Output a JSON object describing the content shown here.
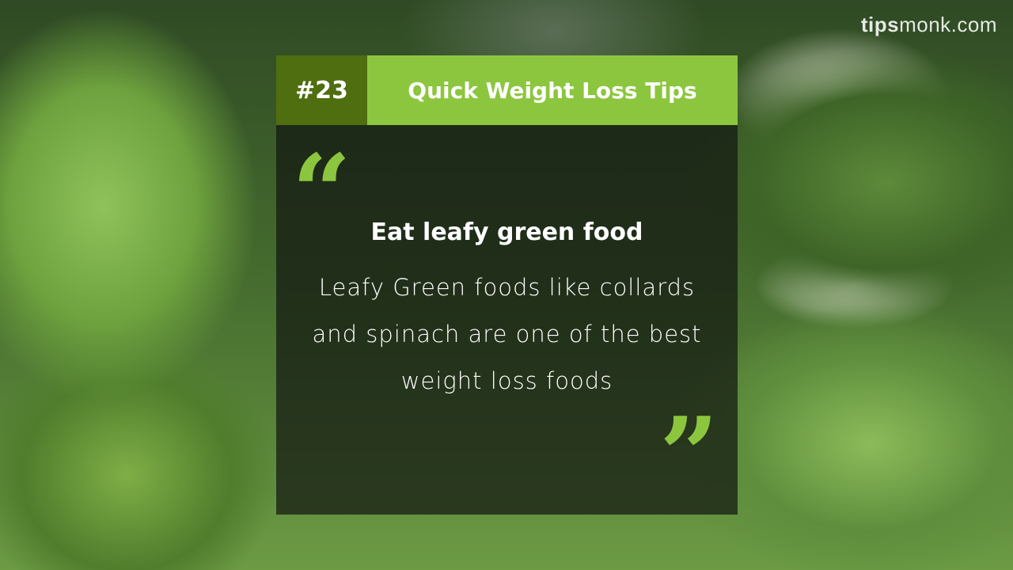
{
  "watermark": {
    "brand_bold": "tips",
    "brand_rest": "monk.com"
  },
  "card": {
    "number": "#23",
    "title": "Quick Weight Loss Tips",
    "heading": "Eat leafy green food",
    "text": "Leafy Green foods like collards and spinach  are one of the best weight loss foods",
    "quote_open": "“",
    "quote_close": "”"
  },
  "colors": {
    "accent": "#8cc63f",
    "accent_dark": "#4e6e10"
  }
}
